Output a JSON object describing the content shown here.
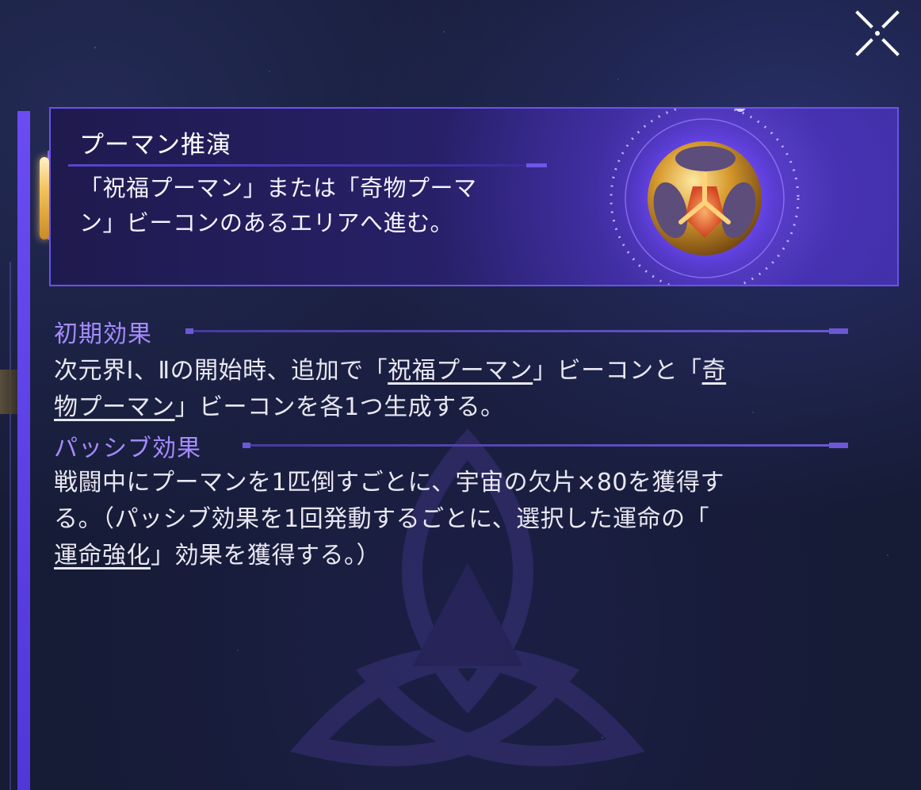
{
  "header": {
    "title": "プーマン推演",
    "description_line1": "「祝福プーマン」または「奇物プーマ",
    "description_line2": "ン」ビーコンのあるエリアへ進む。"
  },
  "initial_effect": {
    "title": "初期効果",
    "line1_pre": "次元界Ⅰ、Ⅱの開始時、追加で「",
    "kw1": "祝福プーマン",
    "line1_mid": "」ビーコンと「",
    "kw2_part1": "奇",
    "kw2_part2": "物プーマン",
    "line2_post": "」ビーコンを各1つ生成する。"
  },
  "passive_effect": {
    "title": "パッシブ効果",
    "line1": "戦闘中にプーマンを1匹倒すごとに、宇宙の欠片×80を獲得す",
    "line2": "る。（パッシブ効果を1回発動するごとに、選択した運命の「",
    "kw": "運命強化",
    "line3_post": "」効果を獲得する。）"
  },
  "icons": {
    "close": "close-icon",
    "emblem": "pouman-cube-icon"
  },
  "colors": {
    "accent": "#6b53ea",
    "section_title": "#a58bff",
    "background": "#161b36"
  }
}
